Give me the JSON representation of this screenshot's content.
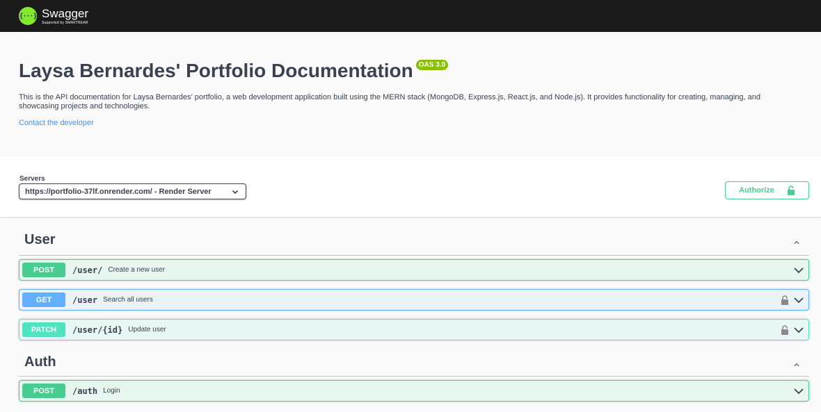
{
  "topbar": {
    "logo_symbol": "{···}",
    "logo_name": "Swagger",
    "logo_sub": "Supported by SMARTBEAR",
    "logo_color": "#85ea2d"
  },
  "info": {
    "title": "Laysa Bernardes' Portfolio Documentation",
    "version_badge": "OAS 3.0",
    "description": "This is the API documentation for Laysa Bernardes' portfolio, a web development application built using the MERN stack (MongoDB, Express.js, React.js, and Node.js). It provides functionality for creating, managing, and showcasing projects and technologies.",
    "contact_label": "Contact the developer"
  },
  "servers": {
    "label": "Servers",
    "selected": "https://portfolio-37lf.onrender.com/ - Render Server"
  },
  "authorize": {
    "label": "Authorize",
    "icon": "lock-icon"
  },
  "tags": [
    {
      "name": "User",
      "operations": [
        {
          "method": "POST",
          "path": "/user/",
          "summary": "Create a new user",
          "locked": false
        },
        {
          "method": "GET",
          "path": "/user",
          "summary": "Search all users",
          "locked": true
        },
        {
          "method": "PATCH",
          "path": "/user/{id}",
          "summary": "Update user",
          "locked": true
        }
      ]
    },
    {
      "name": "Auth",
      "operations": [
        {
          "method": "POST",
          "path": "/auth",
          "summary": "Login",
          "locked": false
        }
      ]
    }
  ],
  "colors": {
    "post": "#49cc90",
    "get": "#61affe",
    "patch": "#50e3c2",
    "link": "#4990e2",
    "badge": "#89bf04"
  }
}
